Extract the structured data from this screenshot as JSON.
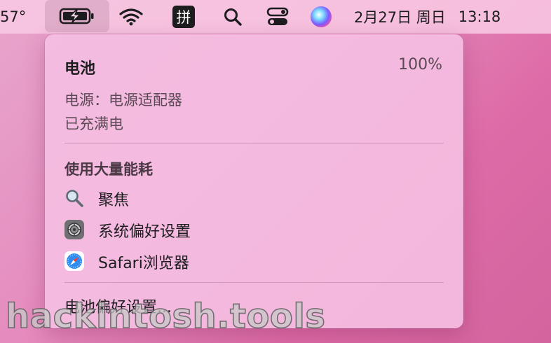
{
  "menubar": {
    "temperature": "57°",
    "ime_label": "拼",
    "date": "2月27日 周日",
    "time": "13:18",
    "icons": [
      "battery-charging-icon",
      "wifi-icon",
      "input-method-icon",
      "search-icon",
      "control-center-icon",
      "siri-icon"
    ]
  },
  "battery_menu": {
    "title": "电池",
    "percent": "100%",
    "power_source": "电源：电源适配器",
    "status": "已充满电",
    "heavy_usage_header": "使用大量能耗",
    "apps": [
      {
        "name": "聚焦",
        "icon": "spotlight-icon"
      },
      {
        "name": "系统偏好设置",
        "icon": "system-preferences-icon"
      },
      {
        "name": "Safari浏览器",
        "icon": "safari-icon"
      }
    ],
    "preferences_link": "电池偏好设置..."
  },
  "watermark": "hackintosh.tools",
  "colors": {
    "menubar_bg": "#f8c8e2",
    "menu_bg": "#f5bee2",
    "text": "#1d1d1f",
    "muted_text": "#5b4a55",
    "battery_green": "#1d1d1f"
  }
}
